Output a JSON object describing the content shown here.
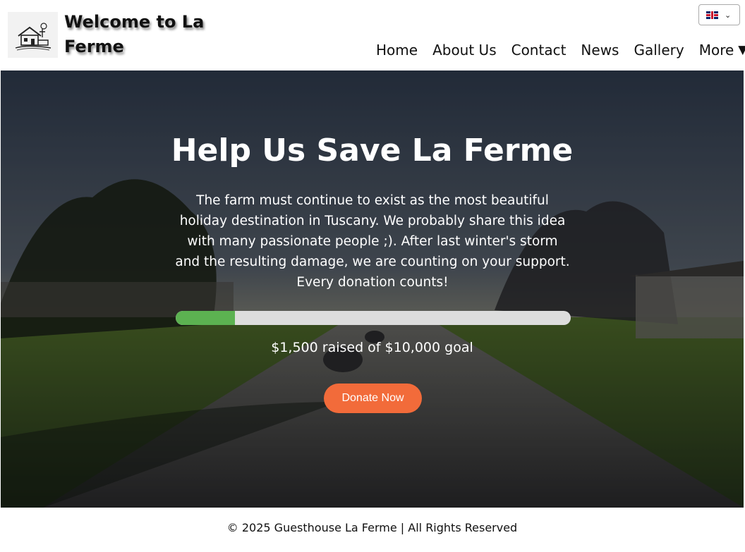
{
  "header": {
    "site_title": "Welcome to La Ferme",
    "language": {
      "selected": "English",
      "flag_icon": "uk-flag-icon"
    },
    "nav": [
      {
        "label": "Home"
      },
      {
        "label": "About Us"
      },
      {
        "label": "Contact"
      },
      {
        "label": "News"
      },
      {
        "label": "Gallery"
      },
      {
        "label": "More",
        "icon": "triangle-down-icon",
        "glyph": "▼"
      }
    ]
  },
  "hero": {
    "title": "Help Us Save La Ferme",
    "text": "The farm must continue to exist as the most beautiful holiday destination in Tuscany. We probably share this idea with many passionate people ;). After last winter's storm and the resulting damage, we are counting on your support. Every donation counts!",
    "progress": {
      "raised": 1500,
      "goal": 10000,
      "fraction": 0.15
    },
    "raised_text": "$1,500 raised of $10,000 goal",
    "donate_label": "Donate Now"
  },
  "footer": {
    "text": "© 2025 Guesthouse La Ferme | All Rights Reserved"
  },
  "colors": {
    "accent_orange": "#f26b3a",
    "progress_green": "#5cb251",
    "progress_track": "#dddddd"
  }
}
